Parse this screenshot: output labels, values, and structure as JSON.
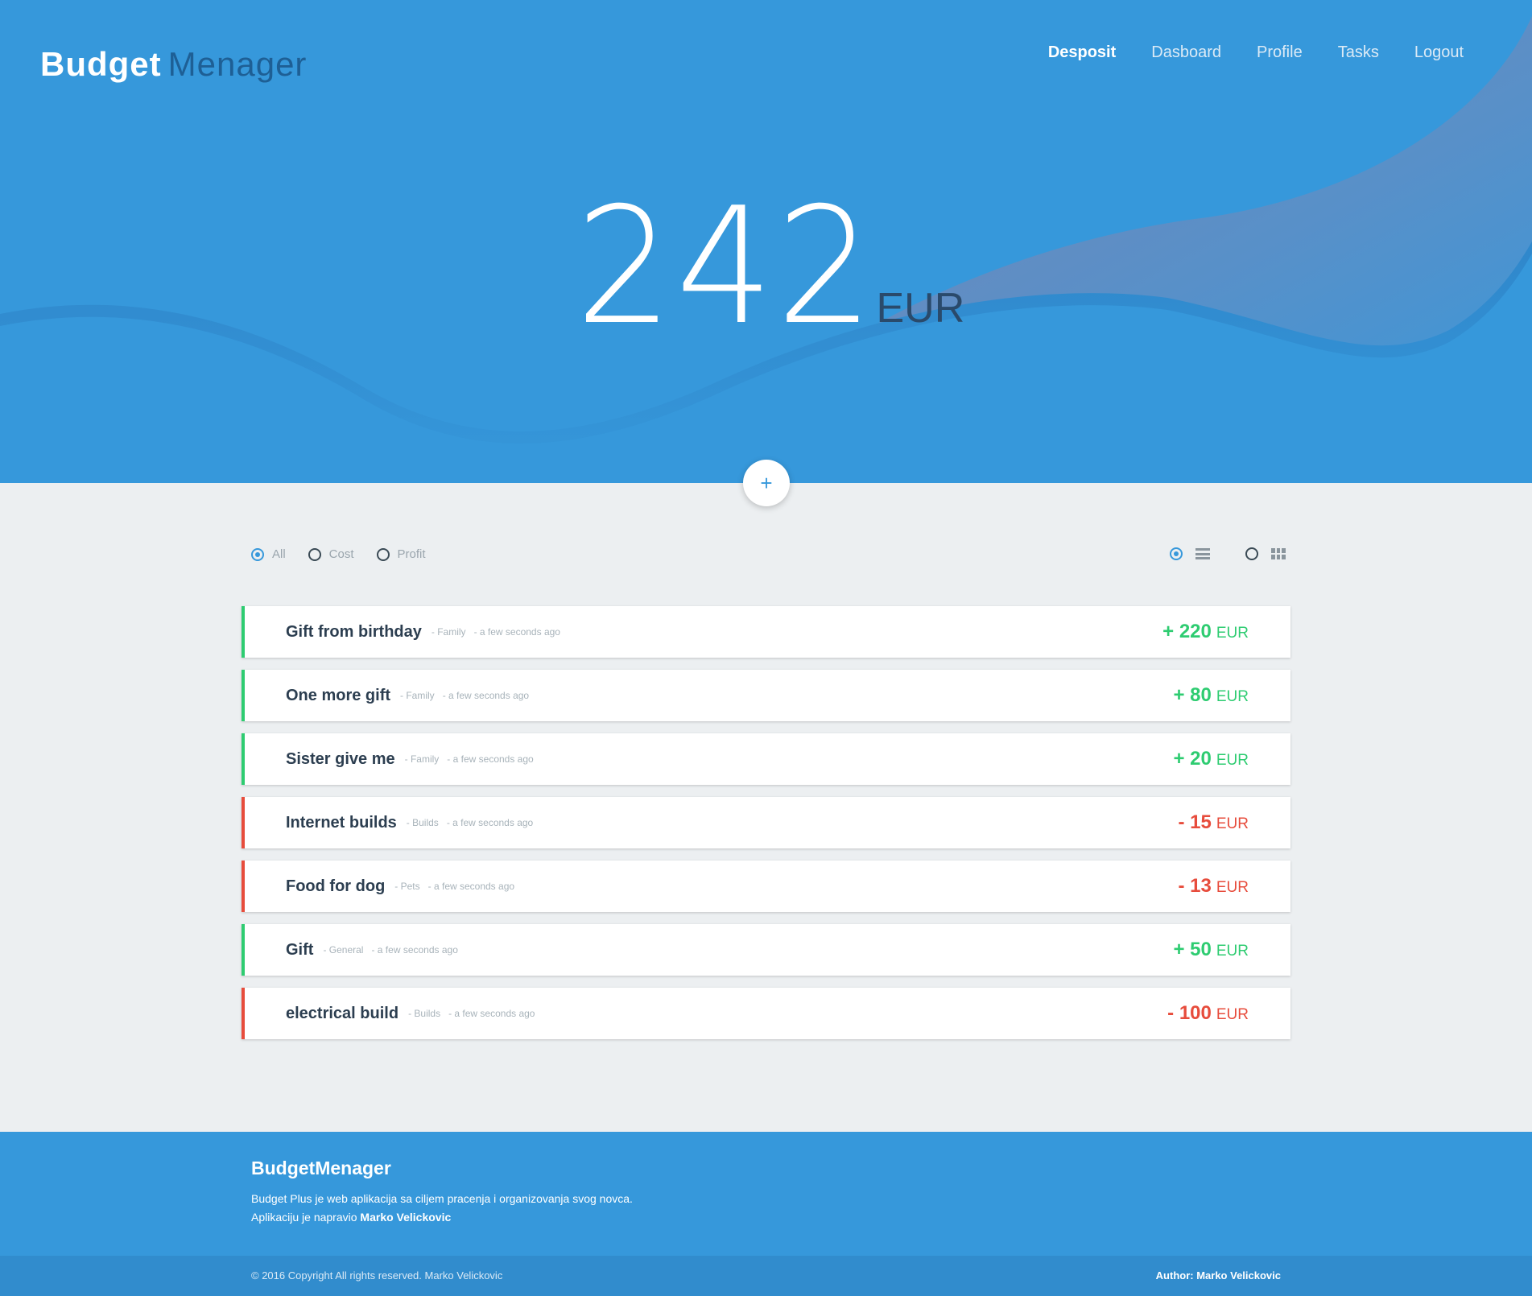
{
  "brand": {
    "part1": "Budget",
    "part2": "Menager"
  },
  "nav": [
    {
      "label": "Desposit",
      "active": true
    },
    {
      "label": "Dasboard",
      "active": false
    },
    {
      "label": "Profile",
      "active": false
    },
    {
      "label": "Tasks",
      "active": false
    },
    {
      "label": "Logout",
      "active": false
    }
  ],
  "balance": {
    "value": "242",
    "currency": "EUR"
  },
  "add_button": {
    "label": "+"
  },
  "filters": [
    {
      "label": "All",
      "selected": true
    },
    {
      "label": "Cost",
      "selected": false
    },
    {
      "label": "Profit",
      "selected": false
    }
  ],
  "view_modes": [
    {
      "icon": "list-view-icon",
      "selected": true
    },
    {
      "icon": "grid-view-icon",
      "selected": false
    }
  ],
  "transactions": [
    {
      "title": "Gift from birthday",
      "category": "- Family",
      "time": "- a few seconds ago",
      "amount": "+ 220",
      "currency": "EUR",
      "type": "profit"
    },
    {
      "title": "One more gift",
      "category": "- Family",
      "time": "- a few seconds ago",
      "amount": "+ 80",
      "currency": "EUR",
      "type": "profit"
    },
    {
      "title": "Sister give me",
      "category": "- Family",
      "time": "- a few seconds ago",
      "amount": "+ 20",
      "currency": "EUR",
      "type": "profit"
    },
    {
      "title": "Internet builds",
      "category": "- Builds",
      "time": "- a few seconds ago",
      "amount": "- 15",
      "currency": "EUR",
      "type": "cost"
    },
    {
      "title": "Food for dog",
      "category": "- Pets",
      "time": "- a few seconds ago",
      "amount": "- 13",
      "currency": "EUR",
      "type": "cost"
    },
    {
      "title": "Gift",
      "category": "- General",
      "time": "- a few seconds ago",
      "amount": "+ 50",
      "currency": "EUR",
      "type": "profit"
    },
    {
      "title": "electrical build",
      "category": "- Builds",
      "time": "- a few seconds ago",
      "amount": "- 100",
      "currency": "EUR",
      "type": "cost"
    }
  ],
  "footer": {
    "title": "BudgetMenager",
    "line1": "Budget Plus je web aplikacija sa ciljem pracenja i organizovanja svog novca.",
    "line2_prefix": "Aplikaciju je napravio",
    "line2_author": "Marko Velickovic",
    "copyright": "© 2016 Copyright All rights reserved. Marko Velickovic",
    "author": "Author: Marko Velickovic"
  },
  "colors": {
    "primary": "#3698db",
    "profit": "#2ecc71",
    "cost": "#e74c3c",
    "background": "#eceff1"
  }
}
